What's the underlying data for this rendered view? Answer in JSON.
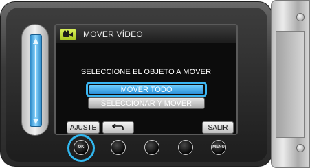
{
  "screen": {
    "mode_icon": "video-camera-icon",
    "title": "MOVER VÍDEO",
    "instruction": "SELECCIONE EL OBJETO A MOVER",
    "options": [
      {
        "label": "MOVER TODO",
        "selected": true
      },
      {
        "label": "SELECCIONAR Y MOVER",
        "selected": false
      }
    ],
    "soft_buttons": {
      "ajuste": "AJUSTE",
      "back_icon": "return-arrow-icon",
      "salir": "SALIR"
    }
  },
  "hardware": {
    "ok_label": "OK",
    "menu_label": "MENU",
    "accent_color": "#31b8f0"
  },
  "slider": {
    "up_icon": "arrow-up-icon",
    "down_icon": "arrow-down-icon"
  }
}
